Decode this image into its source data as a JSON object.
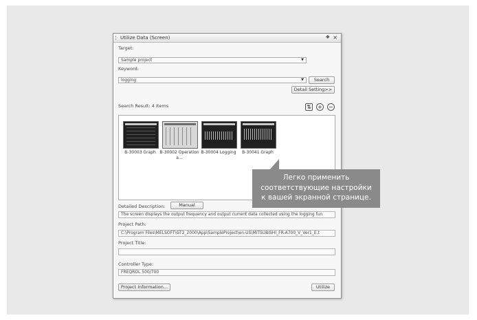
{
  "window": {
    "title": "Utilize Data (Screen)",
    "pin_glyph": "❖",
    "close_glyph": "×"
  },
  "target": {
    "label": "Target:",
    "value": "Sample project"
  },
  "keyword": {
    "label": "Keyword:",
    "value": "logging",
    "search_button": "Search",
    "detail_button": "Detail Setting>>"
  },
  "results": {
    "label": "Search Result: 4 Items",
    "tools": [
      "sort-icon",
      "zoom-in-icon",
      "zoom-out-icon"
    ],
    "items": [
      {
        "label": "B-30003 Graph"
      },
      {
        "label": "B-30002 Operation a..."
      },
      {
        "label": "B-30004 Logging"
      },
      {
        "label": "B-30041 Graph"
      }
    ]
  },
  "description": {
    "label": "Detailed Description:",
    "manual_button": "Manual",
    "text": "The screen displays the output frequency and output current data collected using the logging fun"
  },
  "project_path": {
    "label": "Project Path:",
    "value": "C:\\Program Files\\MELSOFT\\GT2_2000\\App\\SampleProject\\en-US\\MITSUBISHI_FR-A700_V_Ver1_E.t"
  },
  "project_title": {
    "label": "Project Title:",
    "value": ""
  },
  "controller": {
    "label": "Controller Type:",
    "value": "FREQROL 500/700"
  },
  "footer": {
    "project_info_button": "Project Information...",
    "utilize_button": "Utilize"
  },
  "callout": {
    "line1": "Легко применить",
    "line2": "соответствующие настройки",
    "line3": "к вашей экранной странице."
  }
}
